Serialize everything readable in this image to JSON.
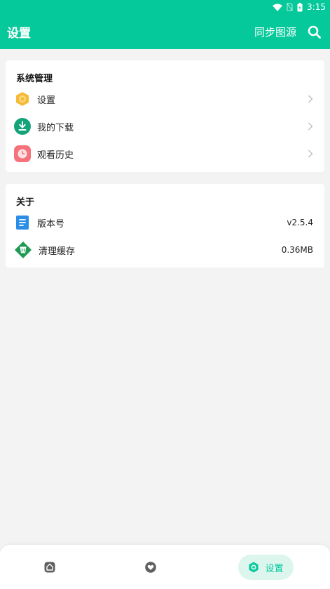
{
  "status_bar": {
    "time": "3:15"
  },
  "app_bar": {
    "title": "设置",
    "sync_label": "同步图源"
  },
  "system_section": {
    "title": "系统管理",
    "items": [
      {
        "label": "设置",
        "icon": "hexagon-settings-icon"
      },
      {
        "label": "我的下载",
        "icon": "download-icon"
      },
      {
        "label": "观看历史",
        "icon": "history-clock-icon"
      }
    ]
  },
  "about_section": {
    "title": "关于",
    "items": [
      {
        "label": "版本号",
        "value": "v2.5.4",
        "icon": "version-doc-icon"
      },
      {
        "label": "清理缓存",
        "value": "0.36MB",
        "icon": "clean-cache-icon"
      }
    ]
  },
  "bottom_nav": {
    "items": [
      {
        "name": "home",
        "icon": "home-icon"
      },
      {
        "name": "favorite",
        "icon": "heart-icon"
      },
      {
        "name": "settings",
        "label": "设置",
        "icon": "gear-icon",
        "active": true
      }
    ]
  },
  "colors": {
    "primary": "#06c99b",
    "background": "#f3f3f3"
  }
}
